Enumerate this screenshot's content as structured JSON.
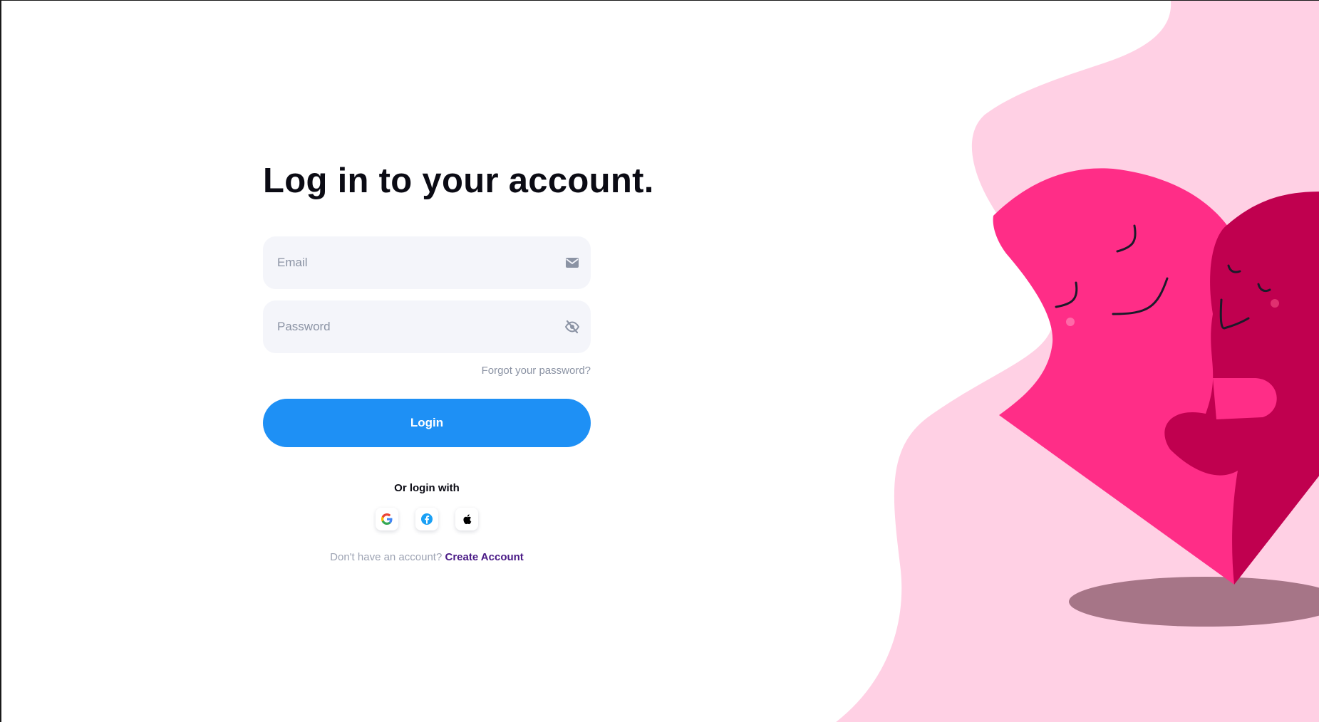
{
  "title": "Log in to your account.",
  "form": {
    "email_placeholder": "Email",
    "password_placeholder": "Password",
    "forgot_password_label": "Forgot your password?",
    "login_button_label": "Login",
    "email_icon": "mail-icon",
    "password_icon": "eye-off-icon"
  },
  "social": {
    "label": "Or login with",
    "providers": [
      {
        "name": "google-icon"
      },
      {
        "name": "facebook-icon"
      },
      {
        "name": "apple-icon"
      }
    ]
  },
  "signup": {
    "prompt": "Don't have an account?",
    "link_label": "Create Account"
  },
  "colors": {
    "primary": "#1e90f5",
    "link": "#4a1a86",
    "background_blob": "#ffd0e4",
    "heart_light": "#ff2d87",
    "heart_dark": "#c0004f",
    "shadow": "#a67587"
  }
}
